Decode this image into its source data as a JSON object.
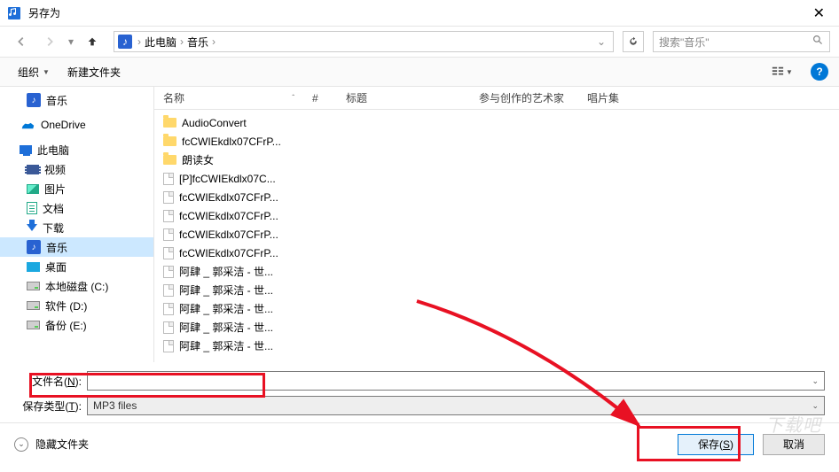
{
  "window": {
    "title": "另存为"
  },
  "breadcrumb": {
    "loc1": "此电脑",
    "loc2": "音乐"
  },
  "search": {
    "placeholder": "搜索\"音乐\""
  },
  "toolbar": {
    "organize": "组织",
    "newfolder": "新建文件夹"
  },
  "columns": {
    "name": "名称",
    "num": "#",
    "title": "标题",
    "artist": "参与创作的艺术家",
    "album": "唱片集"
  },
  "tree": {
    "music": "音乐",
    "onedrive": "OneDrive",
    "thispc": "此电脑",
    "videos": "视频",
    "pictures": "图片",
    "documents": "文档",
    "downloads": "下载",
    "music2": "音乐",
    "desktop": "桌面",
    "diskC": "本地磁盘 (C:)",
    "diskD": "软件 (D:)",
    "diskE": "备份 (E:)"
  },
  "files": [
    {
      "type": "folder",
      "name": "AudioConvert"
    },
    {
      "type": "folder",
      "name": "fcCWIEkdlx07CFrP..."
    },
    {
      "type": "folder",
      "name": "朗读女"
    },
    {
      "type": "file",
      "name": "[P]fcCWIEkdlx07C..."
    },
    {
      "type": "file",
      "name": "fcCWIEkdlx07CFrP..."
    },
    {
      "type": "file",
      "name": "fcCWIEkdlx07CFrP..."
    },
    {
      "type": "file",
      "name": "fcCWIEkdlx07CFrP..."
    },
    {
      "type": "file",
      "name": "fcCWIEkdlx07CFrP..."
    },
    {
      "type": "file",
      "name": "阿肆 _ 郭采洁 - 世..."
    },
    {
      "type": "file",
      "name": "阿肆 _ 郭采洁 - 世..."
    },
    {
      "type": "file",
      "name": "阿肆 _ 郭采洁 - 世..."
    },
    {
      "type": "file",
      "name": "阿肆 _ 郭采洁 - 世..."
    },
    {
      "type": "file",
      "name": "阿肆 _ 郭采洁 - 世..."
    }
  ],
  "fields": {
    "filename_label_pre": "文件名(",
    "filename_label_u": "N",
    "filename_label_post": "):",
    "filename_value": "",
    "savetype_label_pre": "保存类型(",
    "savetype_label_u": "T",
    "savetype_label_post": "):",
    "savetype_value": "MP3 files"
  },
  "footer": {
    "hide": "隐藏文件夹",
    "save_pre": "保存(",
    "save_u": "S",
    "save_post": ")",
    "cancel": "取消"
  },
  "watermark": "下载吧"
}
